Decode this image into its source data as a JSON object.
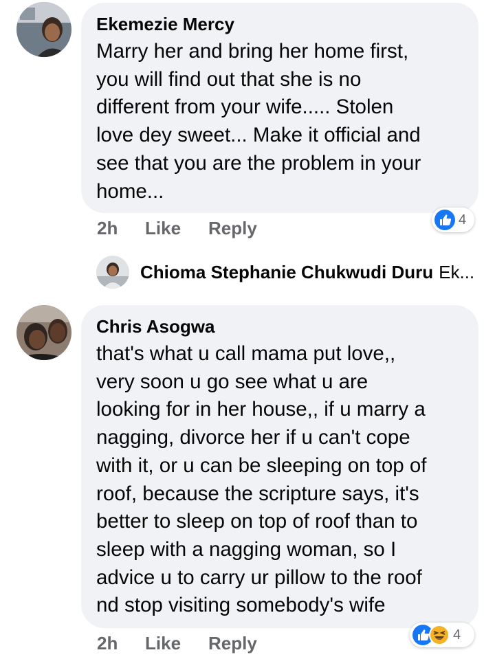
{
  "comments": [
    {
      "author": "Ekemezie Mercy",
      "lines": [
        "Marry her and bring her home first,",
        "you will find out that she is no",
        "different from your wife..... Stolen",
        "love dey sweet... Make it official and",
        "see that you are the problem in your",
        "home..."
      ],
      "time": "2h",
      "like_label": "Like",
      "reply_label": "Reply",
      "reactions": [
        "like"
      ],
      "reaction_count": "4"
    },
    {
      "author": "Chris Asogwa",
      "lines": [
        "that's what u call mama put love,,",
        "very soon u go see what u are",
        "looking for in her house,, if u marry a",
        "nagging, divorce her if u can't cope",
        "with it, or u can be sleeping on top of",
        "roof, because the scripture says, it's",
        "better to sleep on top of roof than to",
        "sleep with a nagging woman, so I",
        "advice u to carry ur pillow to the roof",
        "nd stop visiting somebody's wife"
      ],
      "time": "2h",
      "like_label": "Like",
      "reply_label": "Reply",
      "reactions": [
        "like",
        "haha"
      ],
      "reaction_count": "4"
    }
  ],
  "reply_preview": {
    "name": "Chioma Stephanie Chukwudi Duru",
    "snippet": "Ek..."
  },
  "colors": {
    "bubble": "#f0f2f5",
    "meta_text": "#65676b",
    "like_blue": "#1877f2",
    "haha_yellow": "#f7b125"
  }
}
